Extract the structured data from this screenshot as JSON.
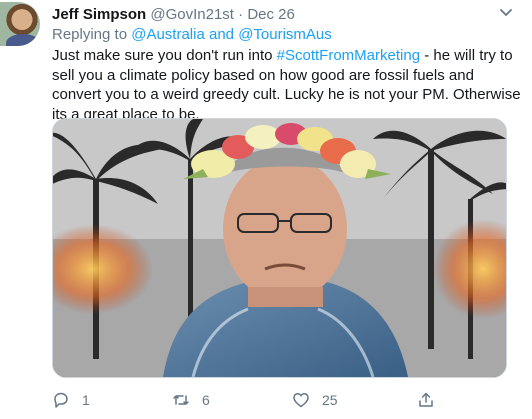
{
  "tweet": {
    "author_name": "Jeff Simpson",
    "author_handle": "@GovIn21st",
    "separator": "·",
    "date": "Dec 26",
    "replying_prefix": "Replying to",
    "replying_to_1": "@Australia",
    "replying_and": "and",
    "replying_to_2": "@TourismAus",
    "text_before_tag": "Just make sure you don't run into ",
    "hashtag": "#ScottFromMarketing",
    "text_after_tag": " - he will try to sell you a climate policy based on how good are fossil fuels and convert you to a weird greedy cult. Lucky he is not your PM. Otherwise its a great place to be.",
    "actions": {
      "reply_count": "1",
      "retweet_count": "6",
      "like_count": "25",
      "share_icon": "share-icon"
    },
    "colors": {
      "link": "#1da1f2",
      "muted": "#657786",
      "text": "#14171a"
    }
  }
}
